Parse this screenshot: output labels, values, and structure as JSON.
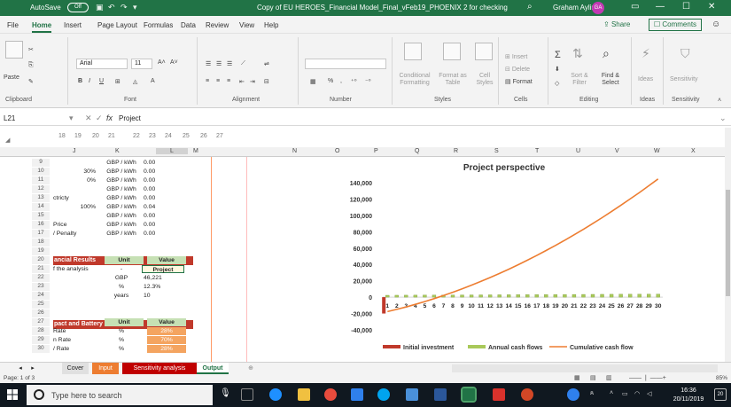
{
  "titlebar": {
    "autosave": "AutoSave",
    "autosave_state": "Off",
    "document_title": "Copy of EU HEROES_Financial Model_Final_vFeb19_PHOENIX 2 for checking",
    "user_name": "Graham Ayling",
    "user_initials": "GA"
  },
  "menu": {
    "tabs": [
      "File",
      "Home",
      "Insert",
      "Page Layout",
      "Formulas",
      "Data",
      "Review",
      "View",
      "Help"
    ],
    "active_tab": "Home",
    "share": "Share",
    "comments": "Comments"
  },
  "ribbon": {
    "paste": "Paste",
    "font_name": "Arial",
    "font_size": "11",
    "groups": [
      "Clipboard",
      "Font",
      "Alignment",
      "Number",
      "Styles",
      "Cells",
      "Editing",
      "Ideas",
      "Sensitivity"
    ],
    "conditional_formatting": "Conditional Formatting",
    "format_as_table": "Format as Table",
    "cell_styles": "Cell Styles",
    "insert": "Insert",
    "delete": "Delete",
    "format": "Format",
    "sort_filter": "Sort & Filter",
    "find_select": "Find & Select",
    "ideas": "Ideas",
    "sensitivity": "Sensitivity"
  },
  "formula_bar": {
    "name_box": "L21",
    "fx": "fx",
    "content": "Project"
  },
  "outline_numbers": [
    "18",
    "19",
    "20",
    "21",
    "22",
    "23",
    "24",
    "25",
    "26",
    "27"
  ],
  "columns": [
    "J",
    "K",
    "L",
    "M",
    "N",
    "O",
    "P",
    "Q",
    "R",
    "S",
    "T",
    "U",
    "V",
    "W",
    "X"
  ],
  "rows": [
    {
      "n": "9",
      "j": "",
      "k": "GBP / kWh",
      "l": "0.00"
    },
    {
      "n": "10",
      "j": "30%",
      "k": "GBP / kWh",
      "l": "0.00"
    },
    {
      "n": "11",
      "j": "0%",
      "k": "GBP / kWh",
      "l": "0.00"
    },
    {
      "n": "12",
      "j": "",
      "k": "GBP / kWh",
      "l": "0.00"
    },
    {
      "n": "13",
      "j": "ctricty",
      "k": "GBP / kWh",
      "l": "0.00"
    },
    {
      "n": "14",
      "j": "100%",
      "k": "GBP / kWh",
      "l": "0.04"
    },
    {
      "n": "15",
      "j": "",
      "k": "GBP / kWh",
      "l": "0.00"
    },
    {
      "n": "16",
      "j": "Price",
      "k": "GBP / kWh",
      "l": "0.00"
    },
    {
      "n": "17",
      "j": "/ Penalty",
      "k": "GBP / kWh",
      "l": "0.00"
    },
    {
      "n": "18",
      "j": "",
      "k": "",
      "l": ""
    },
    {
      "n": "19",
      "j": "",
      "k": "",
      "l": ""
    },
    {
      "n": "20",
      "j": "",
      "k": "Unit",
      "l": "Value"
    },
    {
      "n": "21",
      "j": "f the analysis",
      "k": "-",
      "l": "Project"
    },
    {
      "n": "22",
      "j": "",
      "k": "GBP",
      "l": "46,221"
    },
    {
      "n": "23",
      "j": "",
      "k": "%",
      "l": "12.3%"
    },
    {
      "n": "24",
      "j": "",
      "k": "years",
      "l": "10"
    },
    {
      "n": "25",
      "j": "",
      "k": "",
      "l": ""
    },
    {
      "n": "26",
      "j": "",
      "k": "",
      "l": ""
    },
    {
      "n": "27",
      "j": "",
      "k": "Unit",
      "l": "Value"
    },
    {
      "n": "28",
      "j": "Rate",
      "k": "%",
      "l": "28%"
    },
    {
      "n": "29",
      "j": "n Rate",
      "k": "%",
      "l": "70%"
    },
    {
      "n": "30",
      "j": "/ Rate",
      "k": "%",
      "l": "28%"
    }
  ],
  "section_headers": {
    "financial_results": "ancial Results",
    "impact_battery": "pact and Battery"
  },
  "chart_data": {
    "type": "bar",
    "title": "Project perspective",
    "categories": [
      "1",
      "2",
      "3",
      "4",
      "5",
      "6",
      "7",
      "8",
      "9",
      "10",
      "11",
      "12",
      "13",
      "14",
      "15",
      "16",
      "17",
      "18",
      "19",
      "20",
      "21",
      "22",
      "23",
      "24",
      "25",
      "26",
      "27",
      "28",
      "29",
      "30"
    ],
    "ylim": [
      -40000,
      140000
    ],
    "y_ticks": [
      "140,000",
      "120,000",
      "100,000",
      "80,000",
      "60,000",
      "40,000",
      "20,000",
      "0",
      "-20,000",
      "-40,000"
    ],
    "series": [
      {
        "name": "Initial investment",
        "type": "bar",
        "color": "#c0392b",
        "values": [
          -20000
        ]
      },
      {
        "name": "Annual cash flows",
        "type": "bar",
        "color": "#a9c95a",
        "values": [
          2300,
          2350,
          2400,
          2450,
          2500,
          2550,
          2600,
          2650,
          2700,
          2750,
          2800,
          2850,
          2900,
          2950,
          3000,
          3050,
          3100,
          3150,
          3200,
          3250,
          3300,
          3350,
          3400,
          3450,
          3500,
          3550,
          3600,
          3650,
          3700,
          3750
        ]
      },
      {
        "name": "Cumulative cash flow",
        "type": "line",
        "color": "#ed7d31",
        "values": [
          -17700,
          -15000,
          -12000,
          -8800,
          -5400,
          -1800,
          2000,
          6000,
          10200,
          14600,
          19200,
          24000,
          29000,
          34200,
          39600,
          45200,
          51000,
          57000,
          63200,
          69600,
          76200,
          83000,
          90000,
          97200,
          104600,
          112200,
          120000,
          128000,
          136200,
          144600
        ]
      }
    ]
  },
  "sheet_tabs": [
    {
      "label": "Cover",
      "bg": "#e0e0e0",
      "color": "#222"
    },
    {
      "label": "Input",
      "bg": "#ed7d31",
      "color": "#ffffff"
    },
    {
      "label": "Sensitivity analysis",
      "bg": "#c00000",
      "color": "#ffffff"
    },
    {
      "label": "Output",
      "bg": "#ffffff",
      "color": "#217346"
    }
  ],
  "status": {
    "page": "Page: 1 of 3",
    "zoom": "85%"
  },
  "taskbar": {
    "search_placeholder": "Type here to search",
    "time": "16:36",
    "date": "20/11/2019"
  }
}
